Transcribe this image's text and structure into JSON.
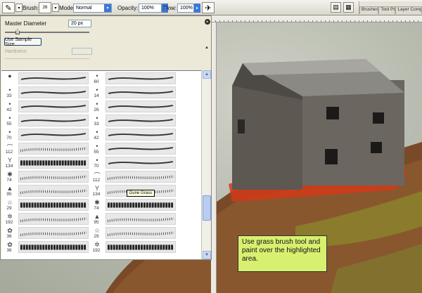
{
  "options_bar": {
    "brush_label": "Brush:",
    "brush_size": "26",
    "mode_label": "Mode:",
    "mode_value": "Normal",
    "opacity_label": "Opacity:",
    "opacity_value": "100%",
    "flow_label": "Flow:",
    "flow_value": "100%",
    "well_tabs": [
      "Brushes",
      "Tool Pr",
      "Layer Comp"
    ]
  },
  "brushes_panel": {
    "master_diameter_label": "Master Diameter",
    "master_diameter_value": "20 px",
    "use_sample_size_label": "Use Sample Size",
    "hardness_label": "Hardness:",
    "tooltip": "Dune Grass",
    "left_column": [
      {
        "num": "",
        "icon": "●"
      },
      {
        "num": "33",
        "icon": "•"
      },
      {
        "num": "42",
        "icon": "•"
      },
      {
        "num": "55",
        "icon": "•"
      },
      {
        "num": "70",
        "icon": "•"
      },
      {
        "num": "112",
        "icon": "⌒"
      },
      {
        "num": "134",
        "icon": "Y"
      },
      {
        "num": "74",
        "icon": "✱"
      },
      {
        "num": "95",
        "icon": "▲"
      },
      {
        "num": "29",
        "icon": "☆"
      },
      {
        "num": "192",
        "icon": "✲"
      },
      {
        "num": "36",
        "icon": "✿"
      },
      {
        "num": "36",
        "icon": "✿"
      }
    ],
    "right_column": [
      {
        "num": "60",
        "icon": "•"
      },
      {
        "num": "14",
        "icon": "•"
      },
      {
        "num": "26",
        "icon": "•"
      },
      {
        "num": "33",
        "icon": "•"
      },
      {
        "num": "42",
        "icon": "•"
      },
      {
        "num": "55",
        "icon": "•"
      },
      {
        "num": "70",
        "icon": "•"
      },
      {
        "num": "112",
        "icon": "⌒"
      },
      {
        "num": "134",
        "icon": "Y"
      },
      {
        "num": "74",
        "icon": "✱"
      },
      {
        "num": "95",
        "icon": "▲"
      },
      {
        "num": "29",
        "icon": "☆"
      },
      {
        "num": "192",
        "icon": "✲"
      }
    ]
  },
  "canvas": {
    "instruction_text": "Use grass brush tool and paint over the highlighted area."
  }
}
